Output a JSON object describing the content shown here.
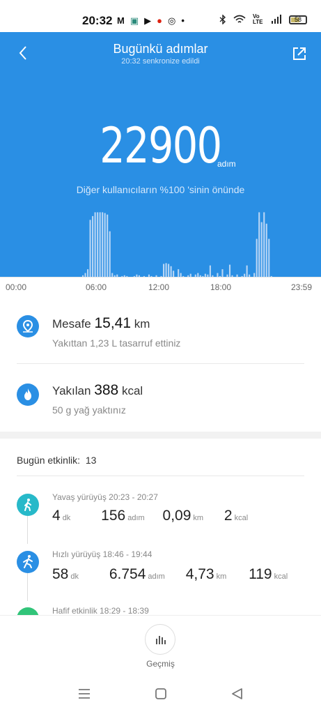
{
  "status_bar": {
    "time": "20:32",
    "apps": [
      "M",
      "▣",
      "▶",
      "●",
      "◎",
      "•"
    ],
    "battery": "58",
    "volte": "Vo LTE"
  },
  "header": {
    "title": "Bugünkü adımlar",
    "subtitle": "20:32 senkronize edildi",
    "back_icon": "chevron-left-icon",
    "share_icon": "share-icon"
  },
  "steps": {
    "count": "22900",
    "unit": "adım",
    "rank_text": "Diğer kullanıcıların %100 'sinin önünde"
  },
  "chart_data": {
    "type": "bar",
    "x_labels": [
      "00:00",
      "06:00",
      "12:00",
      "18:00",
      "23:59"
    ],
    "values": [
      0,
      0,
      0,
      0,
      0,
      0,
      0,
      0,
      0,
      0,
      0,
      0,
      0,
      0,
      0,
      0,
      0,
      0,
      0,
      0,
      0,
      0,
      0,
      0,
      0,
      0,
      0,
      0,
      0,
      2,
      5,
      10,
      75,
      80,
      85,
      85,
      85,
      85,
      84,
      82,
      60,
      5,
      2,
      3,
      0,
      1,
      2,
      1,
      0,
      0,
      1,
      3,
      2,
      0,
      1,
      0,
      3,
      1,
      0,
      2,
      0,
      1,
      17,
      18,
      17,
      14,
      8,
      0,
      10,
      5,
      1,
      0,
      2,
      4,
      0,
      3,
      5,
      2,
      1,
      4,
      3,
      15,
      2,
      0,
      5,
      1,
      10,
      0,
      3,
      16,
      2,
      0,
      3,
      0,
      1,
      4,
      15,
      3,
      0,
      5,
      50,
      85,
      72,
      85,
      70,
      50,
      1,
      0,
      0,
      0,
      0,
      0,
      0,
      0,
      0,
      0,
      0,
      0,
      0,
      0,
      0,
      0
    ],
    "ylim": [
      0,
      90
    ],
    "color": "#b9d6f5"
  },
  "distance": {
    "label": "Mesafe",
    "value": "15,41",
    "unit": "km",
    "desc": "Yakıttan 1,23 L tasarruf ettiniz",
    "icon": "location-pin-icon"
  },
  "calories": {
    "label": "Yakılan",
    "value": "388",
    "unit": "kcal",
    "desc": "50 g yağ yaktınız",
    "icon": "flame-icon"
  },
  "activities": {
    "header": "Bugün etkinlik:",
    "count": "13",
    "items": [
      {
        "name": "Yavaş yürüyüş 20:23 - 20:27",
        "color": "#27b9c9",
        "icon": "walking-icon",
        "v1": "4",
        "u1": "dk",
        "v2": "156",
        "u2": "adım",
        "v3": "0,09",
        "u3": "km",
        "v4": "2",
        "u4": "kcal"
      },
      {
        "name": "Hızlı yürüyüş 18:46 - 19:44",
        "color": "#2a8fe4",
        "icon": "fast-walking-icon",
        "v1": "58",
        "u1": "dk",
        "v2": "6.754",
        "u2": "adım",
        "v3": "4,73",
        "u3": "km",
        "v4": "119",
        "u4": "kcal"
      },
      {
        "name": "Hafif etkinlik 18:29 - 18:39",
        "color": "#31c479",
        "icon": "light-activity-icon"
      }
    ]
  },
  "bottom": {
    "history_label": "Geçmiş",
    "history_icon": "bar-chart-icon"
  },
  "colors": {
    "primary": "#2a8fe4"
  }
}
